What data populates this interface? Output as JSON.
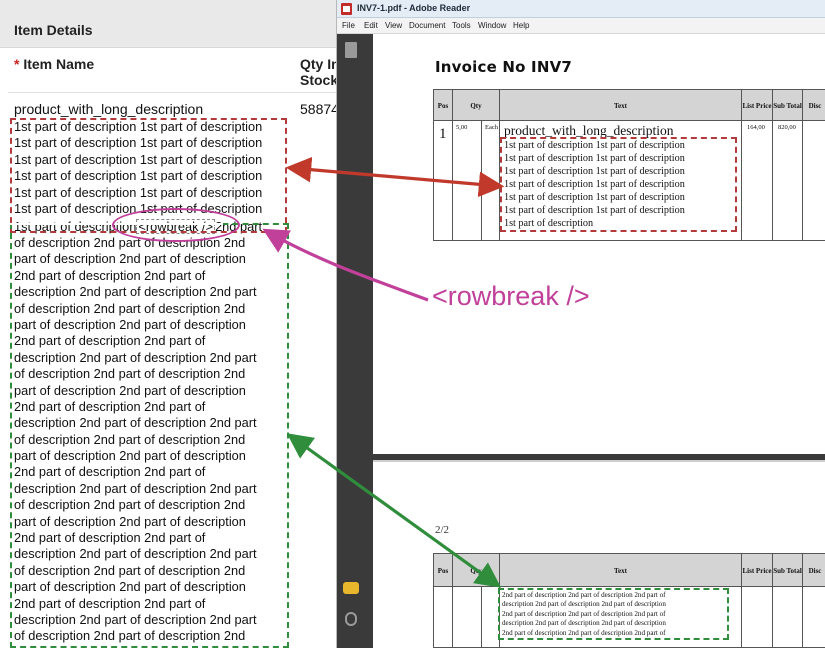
{
  "form": {
    "section_title": "Item Details",
    "required_mark": "*",
    "col_item_name": "Item Name",
    "col_qty": "Qty In\nStock",
    "item_name": "product_with_long_description",
    "qty_value": "58874",
    "desc_part1_lines": [
      "1st part of description 1st part of description",
      "1st part of description 1st part of description",
      "1st part of description 1st part of description",
      "1st part of description 1st part of description",
      "1st part of description 1st part of description",
      "1st part of description 1st part of description"
    ],
    "rowbreak_line": {
      "before": "1st part of description",
      "tag": "<rowbreak />",
      "after": "2nd part"
    },
    "desc_part2_lines": [
      "of description 2nd part of description 2nd",
      "part of description 2nd part of description",
      "2nd part of description 2nd part of",
      "description 2nd part of description 2nd part",
      "of description 2nd part of description 2nd",
      "part of description 2nd part of description",
      "2nd part of description 2nd part of",
      "description 2nd part of description 2nd part",
      "of description 2nd part of description 2nd",
      "part of description 2nd part of description",
      "2nd part of description 2nd part of",
      "description 2nd part of description 2nd part",
      "of description 2nd part of description 2nd",
      "part of description 2nd part of description",
      "2nd part of description 2nd part of",
      "description 2nd part of description 2nd part",
      "of description 2nd part of description 2nd",
      "part of description 2nd part of description",
      "2nd part of description 2nd part of",
      "description 2nd part of description 2nd part",
      "of description 2nd part of description 2nd",
      "part of description 2nd part of description",
      "2nd part of description 2nd part of",
      "description 2nd part of description 2nd part",
      "of description 2nd part of description 2nd"
    ]
  },
  "reader": {
    "window_title": "INV7-1.pdf - Adobe Reader",
    "menu": [
      "File",
      "Edit",
      "View",
      "Document",
      "Tools",
      "Window",
      "Help"
    ],
    "invoice_title": "Invoice No INV7",
    "page_indicator": "2/2",
    "table_headers": {
      "pos": "Pos",
      "qty": "Qty",
      "text": "Text",
      "list_price": "List Price",
      "sub_total": "Sub Total",
      "disc": "Disc"
    },
    "row": {
      "pos": "1",
      "qty": "5,00",
      "unit": "Each",
      "name": "product_with_long_description",
      "list_price": "164,00",
      "sub_total": "820,00"
    },
    "page1_desc_lines": [
      "1st part of description 1st part of description",
      "1st part of description 1st part of description",
      "1st part of description 1st part of description",
      "1st part of description 1st part of description",
      "1st part of description 1st part of description",
      "1st part of description 1st part of description",
      "1st part of description"
    ],
    "page2_desc_lines": [
      "2nd part of description 2nd part of description 2nd part of",
      "description 2nd part of description 2nd part of description",
      "2nd part of description 2nd part of description 2nd part of",
      "description 2nd part of description 2nd part of description",
      "2nd part of description 2nd part of description 2nd part of"
    ]
  },
  "annotation": {
    "rowbreak_label": "<rowbreak />",
    "colors": {
      "red": "#c1392b",
      "green": "#2f8d3c",
      "magenta": "#c0409a"
    }
  }
}
